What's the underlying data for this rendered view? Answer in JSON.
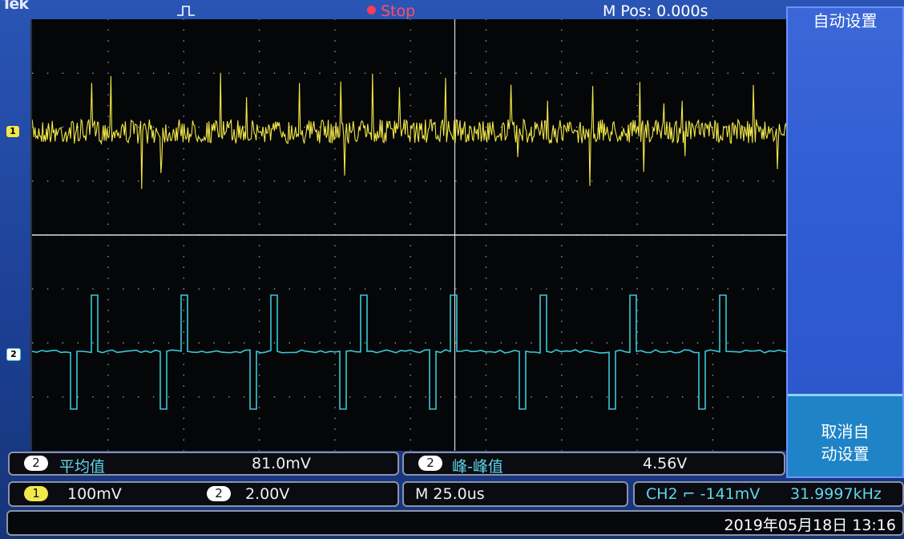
{
  "header": {
    "brand": "Tek",
    "status": "Stop",
    "horizontal_position": "M Pos: 0.000s"
  },
  "menu": {
    "item1": "自动设置",
    "item2_line1": "取消自",
    "item2_line2": "动设置"
  },
  "channels": {
    "ch1_marker": "1",
    "ch2_marker": "2"
  },
  "measurements": {
    "m1": {
      "channel": "2",
      "name": "平均值",
      "value": "81.0mV"
    },
    "m2": {
      "channel": "2",
      "name": "峰-峰值",
      "value": "4.56V"
    }
  },
  "scales": {
    "ch1": {
      "channel": "1",
      "value": "100mV"
    },
    "ch2": {
      "channel": "2",
      "value": "2.00V"
    },
    "timebase": "M 25.0us",
    "trigger": "CH2 ⌐ -141mV",
    "frequency": "31.9997kHz"
  },
  "datetime": "2019年05月18日 13:16",
  "colors": {
    "ch1": "#f2e84a",
    "ch2": "#38c8d8",
    "background": "#050607",
    "menu": "#2f5bd3",
    "stop": "#ff4f6a"
  },
  "waveforms": {
    "ch2_pulse_period_divisions": 1.6,
    "ch2_pulse_high_v": 2.6,
    "ch2_pulse_low_v": -2.6,
    "ch1_noise_level_mv": 20
  }
}
